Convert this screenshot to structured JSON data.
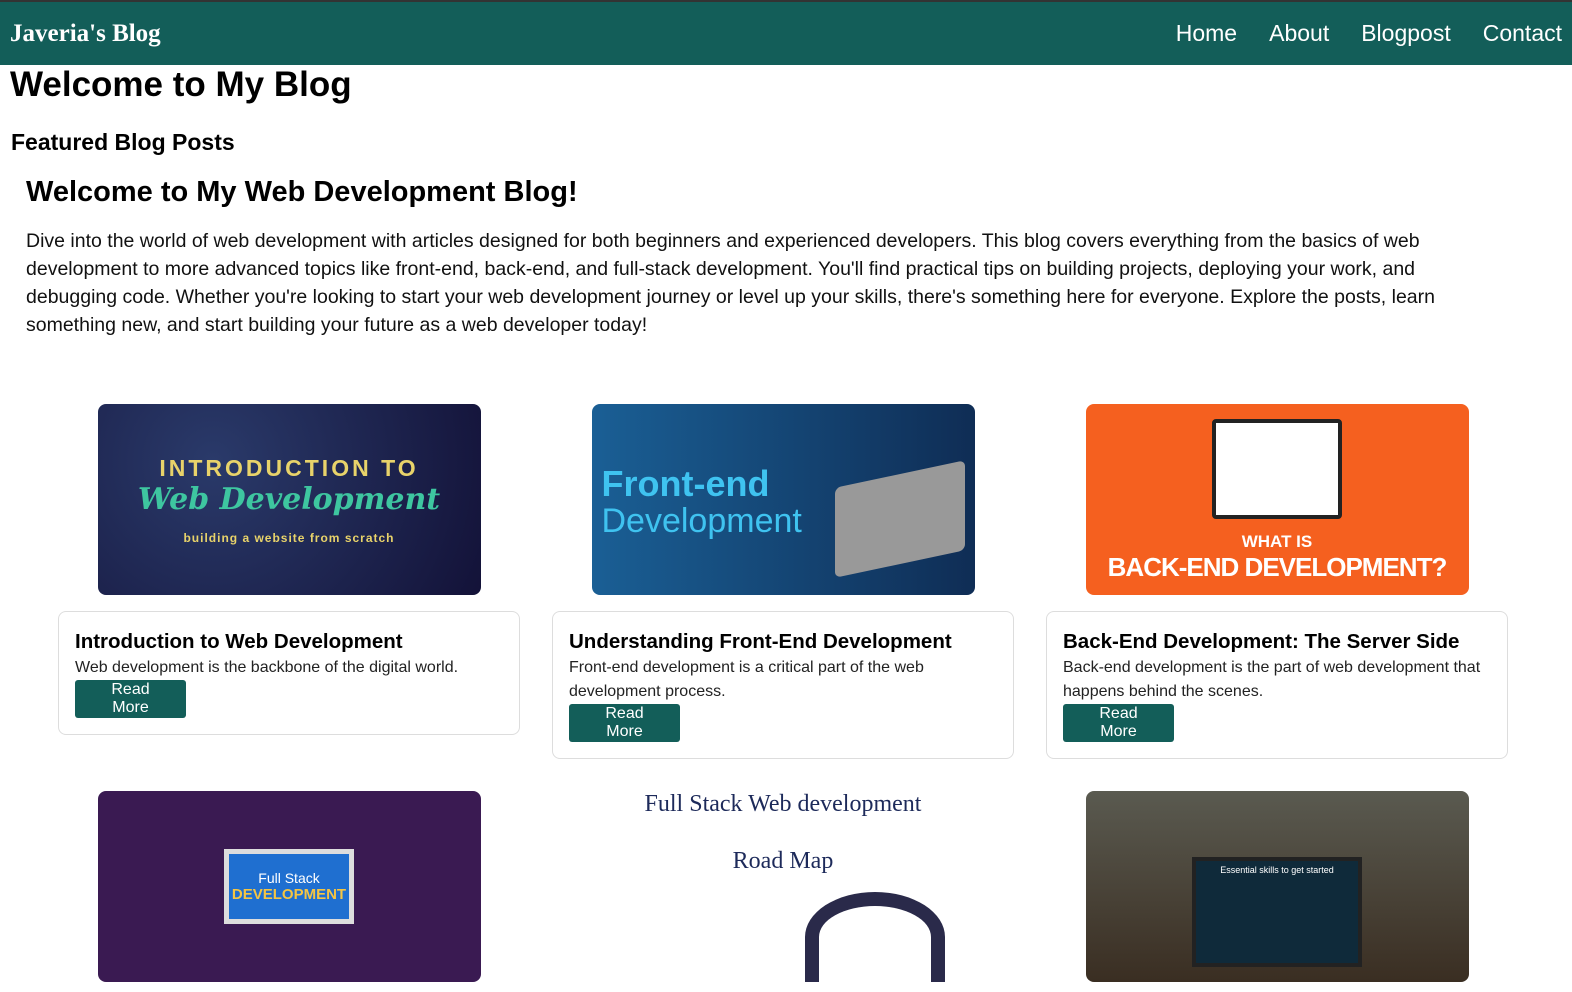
{
  "nav": {
    "brand": "Javeria's Blog",
    "links": [
      "Home",
      "About",
      "Blogpost",
      "Contact"
    ]
  },
  "page_title": "Welcome to My Blog",
  "section_title": "Featured Blog Posts",
  "intro": {
    "heading": "Welcome to My Web Development Blog!",
    "text": "Dive into the world of web development with articles designed for both beginners and experienced developers. This blog covers everything from the basics of web development to more advanced topics like front-end, back-end, and full-stack development. You'll find practical tips on building projects, deploying your work, and debugging code. Whether you're looking to start your web development journey or level up your skills, there's something here for everyone. Explore the posts, learn something new, and start building your future as a web developer today!"
  },
  "posts": [
    {
      "title": "Introduction to Web Development",
      "desc": "Web development is the backbone of the digital world.",
      "button": "Read More",
      "image_text": [
        "INTRODUCTION TO",
        "Web Development",
        "building a website from scratch"
      ],
      "image_bg": "#1c1a4a"
    },
    {
      "title": "Understanding Front-End Development",
      "desc": "Front-end development is a critical part of the web development process.",
      "button": "Read More",
      "image_text": [
        "Front-end",
        "Development"
      ],
      "image_bg": "#14507e"
    },
    {
      "title": "Back-End Development: The Server Side",
      "desc": "Back-end development is the part of web development that happens behind the scenes.",
      "button": "Read More",
      "image_text": [
        "WHAT IS",
        "BACK-END DEVELOPMENT?"
      ],
      "image_bg": "#f5601f"
    },
    {
      "image_text": [
        "Full Stack",
        "DEVELOPMENT"
      ],
      "image_bg": "#3a1a52"
    },
    {
      "image_text": [
        "Full Stack Web development",
        "Road Map"
      ],
      "image_bg": "#ffffff"
    },
    {
      "image_text": [
        "Essential skills to get started"
      ],
      "image_bg": "#4a4a40"
    }
  ]
}
